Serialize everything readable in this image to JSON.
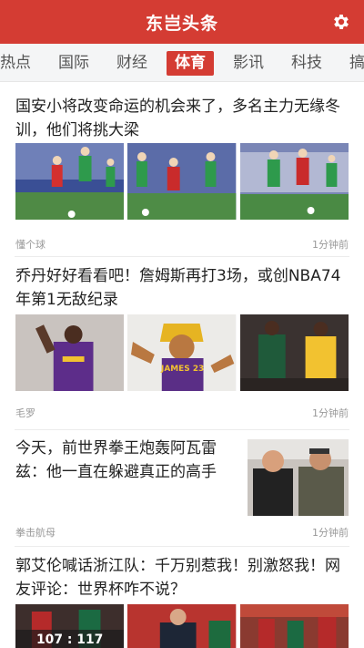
{
  "header": {
    "title": "东岂头条",
    "settings_icon": "gear-icon",
    "background_color": "#d43c33"
  },
  "tabs": [
    {
      "label": "热点",
      "active": false
    },
    {
      "label": "国际",
      "active": false
    },
    {
      "label": "财经",
      "active": false
    },
    {
      "label": "体育",
      "active": true
    },
    {
      "label": "影讯",
      "active": false
    },
    {
      "label": "科技",
      "active": false
    },
    {
      "label": "搞笑",
      "active": false
    }
  ],
  "feed": {
    "items": [
      {
        "title": "国安小将改变命运的机会来了，多名主力无缘冬训，他们将挑大梁",
        "source": "懂个球",
        "time": "1分钟前",
        "images": [
          "football-match-photo",
          "football-match-photo",
          "football-match-photo"
        ]
      },
      {
        "title": "乔丹好好看看吧！詹姆斯再打3场，或创NBA74年第1无敌纪录",
        "source": "毛罗",
        "time": "1分钟前",
        "images": [
          "basketball-player-photo",
          "lakers-player-illustration",
          "basketball-game-photo"
        ],
        "image_text": "JAMES 23"
      },
      {
        "title": "今天，前世界拳王炮轰阿瓦雷兹：他一直在躲避真正的高手",
        "source": "拳击航母",
        "time": "1分钟前",
        "images": [
          "boxers-photo"
        ]
      },
      {
        "title": "郭艾伦喊话浙江队：千万别惹我！别激怒我！网友评论：世界杯咋不说？",
        "images": [
          "basketball-game-photo",
          "coach-photo",
          "basketball-game-photo"
        ],
        "image_text": "107 : 117"
      }
    ]
  }
}
